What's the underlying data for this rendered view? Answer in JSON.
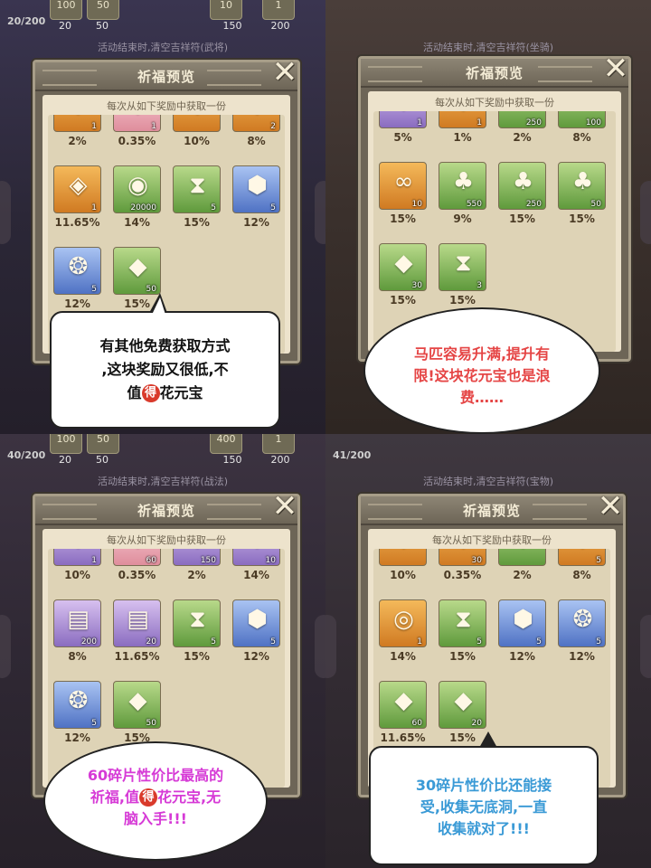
{
  "quadrants": [
    {
      "counter": "20/200",
      "strip_top": [
        "100",
        "50",
        "",
        "10",
        "1"
      ],
      "strip_bottom": [
        "20",
        "50",
        "",
        "150",
        "200"
      ],
      "activity_line": "活动结束时,清空吉祥符(武将)",
      "panel": {
        "title": "祈福预览",
        "close": "✕",
        "subtitle": "每次从如下奖励中获取一份"
      },
      "items": [
        {
          "qty": "1",
          "pct": "2%",
          "color": "orange",
          "icon": "token-icon"
        },
        {
          "qty": "1",
          "pct": "0.35%",
          "color": "pink",
          "icon": "token-icon"
        },
        {
          "qty": "",
          "pct": "10%",
          "color": "orange",
          "icon": "token-icon"
        },
        {
          "qty": "2",
          "pct": "8%",
          "color": "orange",
          "icon": "token-icon"
        },
        {
          "qty": "1",
          "pct": "11.65%",
          "color": "orange",
          "icon": "token-icon"
        },
        {
          "qty": "20000",
          "pct": "14%",
          "color": "green",
          "icon": "coin-icon"
        },
        {
          "qty": "5",
          "pct": "15%",
          "color": "green",
          "icon": "hourglass-icon"
        },
        {
          "qty": "5",
          "pct": "12%",
          "color": "blue",
          "icon": "ingot-icon"
        },
        {
          "qty": "5",
          "pct": "12%",
          "color": "blue",
          "icon": "bag-icon"
        },
        {
          "qty": "50",
          "pct": "15%",
          "color": "green",
          "icon": "shard-icon"
        }
      ],
      "bubble": {
        "line1": "有其他免费获取方式",
        "line2": ",这块奖励又很低,不",
        "line3_pre": "值",
        "de": "得",
        "line3_post": "花元宝"
      }
    },
    {
      "activity_line": "活动结束时,清空吉祥符(坐骑)",
      "panel": {
        "title": "祈福预览",
        "close": "✕",
        "subtitle": "每次从如下奖励中获取一份"
      },
      "items": [
        {
          "qty": "1",
          "pct": "5%",
          "color": "purple",
          "icon": "token-icon"
        },
        {
          "qty": "1",
          "pct": "1%",
          "color": "orange",
          "icon": "token-icon"
        },
        {
          "qty": "250",
          "pct": "2%",
          "color": "green",
          "icon": "bag-icon"
        },
        {
          "qty": "100",
          "pct": "8%",
          "color": "green",
          "icon": "bag-icon"
        },
        {
          "qty": "10",
          "pct": "15%",
          "color": "orange",
          "icon": "chain-icon"
        },
        {
          "qty": "550",
          "pct": "9%",
          "color": "green",
          "icon": "sack-icon"
        },
        {
          "qty": "250",
          "pct": "15%",
          "color": "green",
          "icon": "sack-icon"
        },
        {
          "qty": "50",
          "pct": "15%",
          "color": "green",
          "icon": "sack-icon"
        },
        {
          "qty": "30",
          "pct": "15%",
          "color": "green",
          "icon": "shard-icon"
        },
        {
          "qty": "3",
          "pct": "15%",
          "color": "green",
          "icon": "hourglass-icon"
        }
      ],
      "bubble": {
        "line1": "马匹容易升满,提升有",
        "line2": "限!这块花元宝也是浪",
        "line3": "费……"
      }
    },
    {
      "counter": "40/200",
      "strip_top": [
        "100",
        "50",
        "",
        "400",
        "1"
      ],
      "strip_bottom": [
        "20",
        "50",
        "",
        "150",
        "200"
      ],
      "activity_line": "活动结束时,清空吉祥符(战法)",
      "panel": {
        "title": "祈福预览",
        "close": "✕",
        "subtitle": "每次从如下奖励中获取一份"
      },
      "items": [
        {
          "qty": "1",
          "pct": "10%",
          "color": "purple",
          "icon": "token-icon"
        },
        {
          "qty": "60",
          "pct": "0.35%",
          "color": "pink",
          "icon": "token-icon"
        },
        {
          "qty": "150",
          "pct": "2%",
          "color": "purple",
          "icon": "token-icon"
        },
        {
          "qty": "10",
          "pct": "14%",
          "color": "purple",
          "icon": "token-icon"
        },
        {
          "qty": "200",
          "pct": "8%",
          "color": "purple",
          "icon": "scroll-icon"
        },
        {
          "qty": "20",
          "pct": "11.65%",
          "color": "purple",
          "icon": "scroll-icon"
        },
        {
          "qty": "5",
          "pct": "15%",
          "color": "green",
          "icon": "hourglass-icon"
        },
        {
          "qty": "5",
          "pct": "12%",
          "color": "blue",
          "icon": "ingot-icon"
        },
        {
          "qty": "5",
          "pct": "12%",
          "color": "blue",
          "icon": "bag-icon"
        },
        {
          "qty": "50",
          "pct": "15%",
          "color": "green",
          "icon": "shard-icon"
        }
      ],
      "bubble": {
        "line1": "60碎片性价比最高的",
        "line2_pre": "祈福,值",
        "de": "得",
        "line2_post": "花元宝,无",
        "line3": "脑入手!!!"
      }
    },
    {
      "counter": "41/200",
      "activity_line": "活动结束时,清空吉祥符(宝物)",
      "panel": {
        "title": "祈福预览",
        "close": "✕",
        "subtitle": "每次从如下奖励中获取一份"
      },
      "items": [
        {
          "qty": "",
          "pct": "10%",
          "color": "orange",
          "icon": "token-icon"
        },
        {
          "qty": "30",
          "pct": "0.35%",
          "color": "orange",
          "icon": "token-icon"
        },
        {
          "qty": "",
          "pct": "2%",
          "color": "green",
          "icon": "token-icon"
        },
        {
          "qty": "5",
          "pct": "8%",
          "color": "orange",
          "icon": "token-icon"
        },
        {
          "qty": "1",
          "pct": "14%",
          "color": "orange",
          "icon": "jade-icon"
        },
        {
          "qty": "5",
          "pct": "15%",
          "color": "green",
          "icon": "hourglass-icon"
        },
        {
          "qty": "5",
          "pct": "12%",
          "color": "blue",
          "icon": "ingot-icon"
        },
        {
          "qty": "5",
          "pct": "12%",
          "color": "blue",
          "icon": "bag-icon"
        },
        {
          "qty": "60",
          "pct": "11.65%",
          "color": "green",
          "icon": "shard-icon"
        },
        {
          "qty": "20",
          "pct": "15%",
          "color": "green",
          "icon": "shard-icon"
        }
      ],
      "bubble": {
        "line1": "30碎片性价比还能接",
        "line2": "受,收集无底洞,一直",
        "line3": "收集就对了!!!"
      }
    }
  ]
}
